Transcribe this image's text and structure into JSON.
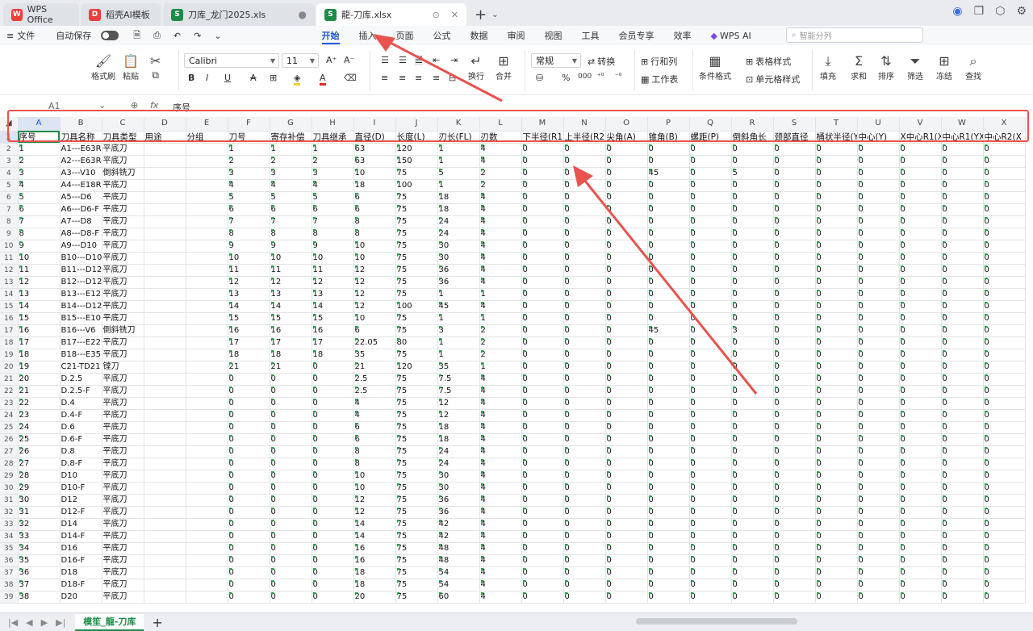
{
  "tabs": [
    {
      "label": "WPS Office",
      "icon": "wps-logo-icon",
      "color": "#e8403a"
    },
    {
      "label": "稻壳AI模板",
      "icon": "docer-logo-icon",
      "color": "#e8403a"
    },
    {
      "label": "刀库_龙门2025.xls",
      "icon": "sheet-logo-icon",
      "color": "#1e8b47"
    },
    {
      "label": "龍-刀库.xlsx",
      "icon": "sheet-logo-icon",
      "color": "#1e8b47"
    }
  ],
  "menu": {
    "file": "文件",
    "autosave": "自动保存",
    "tabs": [
      "开始",
      "插入",
      "页面",
      "公式",
      "数据",
      "审阅",
      "视图",
      "工具",
      "会员专享",
      "效率",
      "WPS AI"
    ],
    "active_tab": "开始",
    "search_placeholder": "智能分列"
  },
  "ribbon": {
    "format_painter": "格式刷",
    "paste": "粘贴",
    "font_name": "Calibri",
    "font_size": "11",
    "number_format": "常规",
    "convert": "转换",
    "rows_cols": "行和列",
    "worksheet": "工作表",
    "conditional_format": "条件格式",
    "table_style": "表格样式",
    "cell_style": "单元格样式",
    "wrap": "换行",
    "merge": "合并",
    "fill": "填充",
    "sum": "求和",
    "sort": "排序",
    "filter": "筛选",
    "freeze": "冻结",
    "find": "查找"
  },
  "formula_bar": {
    "cell_ref": "A1",
    "fx": "fx",
    "content": "序号"
  },
  "columns": [
    "A",
    "B",
    "C",
    "D",
    "E",
    "F",
    "G",
    "H",
    "I",
    "J",
    "K",
    "L",
    "M",
    "N",
    "O",
    "P",
    "Q",
    "R",
    "S",
    "T",
    "U",
    "V",
    "W",
    "X"
  ],
  "header_row": [
    "序号",
    "刀具名称",
    "刀具类型",
    "用途",
    "分组",
    "刀号",
    "寄存补偿",
    "刀具继承",
    "直径(D)",
    "长度(L)",
    "刃长(FL)",
    "刃数",
    "下半径(R1",
    "上半径(R2",
    "尖角(A)",
    "锥角(B)",
    "螺距(P)",
    "倒斜角长",
    "颈部直径",
    "桶状半径(Y",
    "中心(Y)",
    "X中心R1(XY",
    "中心R1(YX",
    "中心R2(X"
  ],
  "rows": [
    [
      "1",
      "A1---E63R",
      "平底刀",
      "",
      "",
      "1",
      "1",
      "1",
      "63",
      "120",
      "1",
      "4",
      "0",
      "0",
      "0",
      "0",
      "0",
      "0",
      "0",
      "0",
      "0",
      "0",
      "0",
      "0"
    ],
    [
      "2",
      "A2---E63R-",
      "平底刀",
      "",
      "",
      "2",
      "2",
      "2",
      "63",
      "150",
      "1",
      "4",
      "0",
      "0",
      "0",
      "0",
      "0",
      "0",
      "0",
      "0",
      "0",
      "0",
      "0",
      "0"
    ],
    [
      "3",
      "A3---V10",
      "倒斜铣刀",
      "",
      "",
      "3",
      "3",
      "3",
      "10",
      "75",
      "5",
      "2",
      "0",
      "0",
      "0",
      "45",
      "0",
      "5",
      "0",
      "0",
      "0",
      "0",
      "0",
      "0"
    ],
    [
      "4",
      "A4---E18R",
      "平底刀",
      "",
      "",
      "4",
      "4",
      "4",
      "18",
      "100",
      "1",
      "2",
      "0",
      "0",
      "0",
      "0",
      "0",
      "0",
      "0",
      "0",
      "0",
      "0",
      "0",
      "0"
    ],
    [
      "5",
      "A5---D6",
      "平底刀",
      "",
      "",
      "5",
      "5",
      "5",
      "6",
      "75",
      "18",
      "4",
      "0",
      "0",
      "0",
      "0",
      "0",
      "0",
      "0",
      "0",
      "0",
      "0",
      "0",
      "0"
    ],
    [
      "6",
      "A6---D6-F",
      "平底刀",
      "",
      "",
      "6",
      "6",
      "6",
      "6",
      "75",
      "18",
      "4",
      "0",
      "0",
      "0",
      "0",
      "0",
      "0",
      "0",
      "0",
      "0",
      "0",
      "0",
      "0"
    ],
    [
      "7",
      "A7---D8",
      "平底刀",
      "",
      "",
      "7",
      "7",
      "7",
      "8",
      "75",
      "24",
      "4",
      "0",
      "0",
      "0",
      "0",
      "0",
      "0",
      "0",
      "0",
      "0",
      "0",
      "0",
      "0"
    ],
    [
      "8",
      "A8---D8-F",
      "平底刀",
      "",
      "",
      "8",
      "8",
      "8",
      "8",
      "75",
      "24",
      "4",
      "0",
      "0",
      "0",
      "0",
      "0",
      "0",
      "0",
      "0",
      "0",
      "0",
      "0",
      "0"
    ],
    [
      "9",
      "A9---D10",
      "平底刀",
      "",
      "",
      "9",
      "9",
      "9",
      "10",
      "75",
      "30",
      "4",
      "0",
      "0",
      "0",
      "0",
      "0",
      "0",
      "0",
      "0",
      "0",
      "0",
      "0",
      "0"
    ],
    [
      "10",
      "B10---D10-",
      "平底刀",
      "",
      "",
      "10",
      "10",
      "10",
      "10",
      "75",
      "30",
      "4",
      "0",
      "0",
      "0",
      "0",
      "0",
      "0",
      "0",
      "0",
      "0",
      "0",
      "0",
      "0"
    ],
    [
      "11",
      "B11---D12",
      "平底刀",
      "",
      "",
      "11",
      "11",
      "11",
      "12",
      "75",
      "36",
      "4",
      "0",
      "0",
      "0",
      "0",
      "0",
      "0",
      "0",
      "0",
      "0",
      "0",
      "0",
      "0"
    ],
    [
      "12",
      "B12---D12-",
      "平底刀",
      "",
      "",
      "12",
      "12",
      "12",
      "12",
      "75",
      "36",
      "4",
      "0",
      "0",
      "0",
      "0",
      "0",
      "0",
      "0",
      "0",
      "0",
      "0",
      "0",
      "0"
    ],
    [
      "13",
      "B13---E12F",
      "平底刀",
      "",
      "",
      "13",
      "13",
      "13",
      "12",
      "75",
      "1",
      "1",
      "0",
      "0",
      "0",
      "0",
      "0",
      "0",
      "0",
      "0",
      "0",
      "0",
      "0",
      "0"
    ],
    [
      "14",
      "B14---D12-",
      "平底刀",
      "",
      "",
      "14",
      "14",
      "14",
      "12",
      "100",
      "45",
      "4",
      "0",
      "0",
      "0",
      "0",
      "0",
      "0",
      "0",
      "0",
      "0",
      "0",
      "0",
      "0"
    ],
    [
      "15",
      "B15---E10F",
      "平底刀",
      "",
      "",
      "15",
      "15",
      "15",
      "10",
      "75",
      "1",
      "1",
      "0",
      "0",
      "0",
      "0",
      "0",
      "0",
      "0",
      "0",
      "0",
      "0",
      "0",
      "0"
    ],
    [
      "16",
      "B16---V6",
      "倒斜铣刀",
      "",
      "",
      "16",
      "16",
      "16",
      "6",
      "75",
      "3",
      "2",
      "0",
      "0",
      "0",
      "45",
      "0",
      "3",
      "0",
      "0",
      "0",
      "0",
      "0",
      "0"
    ],
    [
      "17",
      "B17---E22F",
      "平底刀",
      "",
      "",
      "17",
      "17",
      "17",
      "22.05",
      "80",
      "1",
      "2",
      "0",
      "0",
      "0",
      "0",
      "0",
      "0",
      "0",
      "0",
      "0",
      "0",
      "0",
      "0"
    ],
    [
      "18",
      "B18---E35F",
      "平底刀",
      "",
      "",
      "18",
      "18",
      "18",
      "35",
      "75",
      "1",
      "2",
      "0",
      "0",
      "0",
      "0",
      "0",
      "0",
      "0",
      "0",
      "0",
      "0",
      "0",
      "0"
    ],
    [
      "19",
      "C21-TD21",
      "镗刀",
      "",
      "",
      "21",
      "21",
      "0",
      "21",
      "120",
      "35",
      "1",
      "0",
      "0",
      "0",
      "0",
      "0",
      "0",
      "0",
      "0",
      "0",
      "0",
      "0",
      "0"
    ],
    [
      "20",
      "D.2.5",
      "平底刀",
      "",
      "",
      "0",
      "0",
      "0",
      "2.5",
      "75",
      "7.5",
      "4",
      "0",
      "0",
      "0",
      "0",
      "0",
      "0",
      "0",
      "0",
      "0",
      "0",
      "0",
      "0"
    ],
    [
      "21",
      "D.2.5-F",
      "平底刀",
      "",
      "",
      "0",
      "0",
      "0",
      "2.5",
      "75",
      "7.5",
      "4",
      "0",
      "0",
      "0",
      "0",
      "0",
      "0",
      "0",
      "0",
      "0",
      "0",
      "0",
      "0"
    ],
    [
      "22",
      "D.4",
      "平底刀",
      "",
      "",
      "0",
      "0",
      "0",
      "4",
      "75",
      "12",
      "4",
      "0",
      "0",
      "0",
      "0",
      "0",
      "0",
      "0",
      "0",
      "0",
      "0",
      "0",
      "0"
    ],
    [
      "23",
      "D.4-F",
      "平底刀",
      "",
      "",
      "0",
      "0",
      "0",
      "4",
      "75",
      "12",
      "4",
      "0",
      "0",
      "0",
      "0",
      "0",
      "0",
      "0",
      "0",
      "0",
      "0",
      "0",
      "0"
    ],
    [
      "24",
      "D.6",
      "平底刀",
      "",
      "",
      "0",
      "0",
      "0",
      "6",
      "75",
      "18",
      "4",
      "0",
      "0",
      "0",
      "0",
      "0",
      "0",
      "0",
      "0",
      "0",
      "0",
      "0",
      "0"
    ],
    [
      "25",
      "D.6-F",
      "平底刀",
      "",
      "",
      "0",
      "0",
      "0",
      "6",
      "75",
      "18",
      "4",
      "0",
      "0",
      "0",
      "0",
      "0",
      "0",
      "0",
      "0",
      "0",
      "0",
      "0",
      "0"
    ],
    [
      "26",
      "D.8",
      "平底刀",
      "",
      "",
      "0",
      "0",
      "0",
      "8",
      "75",
      "24",
      "4",
      "0",
      "0",
      "0",
      "0",
      "0",
      "0",
      "0",
      "0",
      "0",
      "0",
      "0",
      "0"
    ],
    [
      "27",
      "D.8-F",
      "平底刀",
      "",
      "",
      "0",
      "0",
      "0",
      "8",
      "75",
      "24",
      "4",
      "0",
      "0",
      "0",
      "0",
      "0",
      "0",
      "0",
      "0",
      "0",
      "0",
      "0",
      "0"
    ],
    [
      "28",
      "D10",
      "平底刀",
      "",
      "",
      "0",
      "0",
      "0",
      "10",
      "75",
      "30",
      "4",
      "0",
      "0",
      "0",
      "0",
      "0",
      "0",
      "0",
      "0",
      "0",
      "0",
      "0",
      "0"
    ],
    [
      "29",
      "D10-F",
      "平底刀",
      "",
      "",
      "0",
      "0",
      "0",
      "10",
      "75",
      "30",
      "4",
      "0",
      "0",
      "0",
      "0",
      "0",
      "0",
      "0",
      "0",
      "0",
      "0",
      "0",
      "0"
    ],
    [
      "30",
      "D12",
      "平底刀",
      "",
      "",
      "0",
      "0",
      "0",
      "12",
      "75",
      "36",
      "4",
      "0",
      "0",
      "0",
      "0",
      "0",
      "0",
      "0",
      "0",
      "0",
      "0",
      "0",
      "0"
    ],
    [
      "31",
      "D12-F",
      "平底刀",
      "",
      "",
      "0",
      "0",
      "0",
      "12",
      "75",
      "36",
      "4",
      "0",
      "0",
      "0",
      "0",
      "0",
      "0",
      "0",
      "0",
      "0",
      "0",
      "0",
      "0"
    ],
    [
      "32",
      "D14",
      "平底刀",
      "",
      "",
      "0",
      "0",
      "0",
      "14",
      "75",
      "42",
      "4",
      "0",
      "0",
      "0",
      "0",
      "0",
      "0",
      "0",
      "0",
      "0",
      "0",
      "0",
      "0"
    ],
    [
      "33",
      "D14-F",
      "平底刀",
      "",
      "",
      "0",
      "0",
      "0",
      "14",
      "75",
      "42",
      "4",
      "0",
      "0",
      "0",
      "0",
      "0",
      "0",
      "0",
      "0",
      "0",
      "0",
      "0",
      "0"
    ],
    [
      "34",
      "D16",
      "平底刀",
      "",
      "",
      "0",
      "0",
      "0",
      "16",
      "75",
      "48",
      "4",
      "0",
      "0",
      "0",
      "0",
      "0",
      "0",
      "0",
      "0",
      "0",
      "0",
      "0",
      "0"
    ],
    [
      "35",
      "D16-F",
      "平底刀",
      "",
      "",
      "0",
      "0",
      "0",
      "16",
      "75",
      "48",
      "4",
      "0",
      "0",
      "0",
      "0",
      "0",
      "0",
      "0",
      "0",
      "0",
      "0",
      "0",
      "0"
    ],
    [
      "36",
      "D18",
      "平底刀",
      "",
      "",
      "0",
      "0",
      "0",
      "18",
      "75",
      "54",
      "4",
      "0",
      "0",
      "0",
      "0",
      "0",
      "0",
      "0",
      "0",
      "0",
      "0",
      "0",
      "0"
    ],
    [
      "37",
      "D18-F",
      "平底刀",
      "",
      "",
      "0",
      "0",
      "0",
      "18",
      "75",
      "54",
      "4",
      "0",
      "0",
      "0",
      "0",
      "0",
      "0",
      "0",
      "0",
      "0",
      "0",
      "0",
      "0"
    ],
    [
      "38",
      "D20",
      "平底刀",
      "",
      "",
      "0",
      "0",
      "0",
      "20",
      "75",
      "60",
      "4",
      "0",
      "0",
      "0",
      "0",
      "0",
      "0",
      "0",
      "0",
      "0",
      "0",
      "0",
      "0"
    ]
  ],
  "sheet_tab": "模笙_龍-刀库",
  "colors": {
    "accent": "#1a56d6",
    "sheet_green": "#1e8b47",
    "annotation_red": "#e8534f"
  }
}
